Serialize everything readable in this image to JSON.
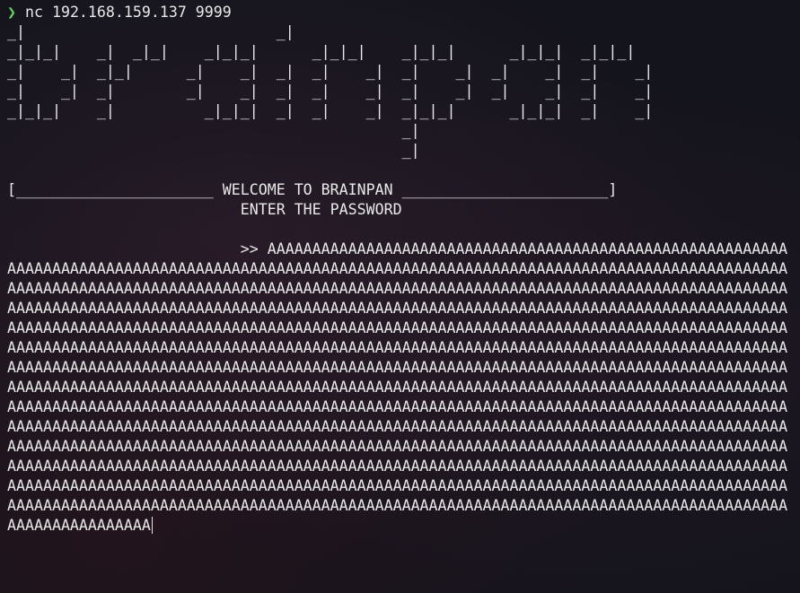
{
  "prompt": {
    "symbol": "❯",
    "command": " nc 192.168.159.137 9999"
  },
  "banner_art": "_|                            _|                                        \n_|_|_|    _|  _|_|    _|_|_|      _|_|_|    _|_|_|      _|_|_|  _|_|_|  \n_|    _|  _|_|      _|    _|  _|  _|    _|  _|    _|  _|    _|  _|    _|\n_|    _|  _|        _|    _|  _|  _|    _|  _|    _|  _|    _|  _|    _|\n_|_|_|    _|          _|_|_|  _|  _|    _|  _|_|_|      _|_|_|  _|    _|\n                                            _|                          \n                                            _|",
  "welcome_line": "[______________________ WELCOME TO BRAINPAN _______________________]",
  "password_prompt_line": "                          ENTER THE PASSWORD",
  "input_prefix": "                          >> ",
  "input_value": "AAAAAAAAAAAAAAAAAAAAAAAAAAAAAAAAAAAAAAAAAAAAAAAAAAAAAAAAAAAAAAAAAAAAAAAAAAAAAAAAAAAAAAAAAAAAAAAAAAAAAAAAAAAAAAAAAAAAAAAAAAAAAAAAAAAAAAAAAAAAAAAAAAAAAAAAAAAAAAAAAAAAAAAAAAAAAAAAAAAAAAAAAAAAAAAAAAAAAAAAAAAAAAAAAAAAAAAAAAAAAAAAAAAAAAAAAAAAAAAAAAAAAAAAAAAAAAAAAAAAAAAAAAAAAAAAAAAAAAAAAAAAAAAAAAAAAAAAAAAAAAAAAAAAAAAAAAAAAAAAAAAAAAAAAAAAAAAAAAAAAAAAAAAAAAAAAAAAAAAAAAAAAAAAAAAAAAAAAAAAAAAAAAAAAAAAAAAAAAAAAAAAAAAAAAAAAAAAAAAAAAAAAAAAAAAAAAAAAAAAAAAAAAAAAAAAAAAAAAAAAAAAAAAAAAAAAAAAAAAAAAAAAAAAAAAAAAAAAAAAAAAAAAAAAAAAAAAAAAAAAAAAAAAAAAAAAAAAAAAAAAAAAAAAAAAAAAAAAAAAAAAAAAAAAAAAAAAAAAAAAAAAAAAAAAAAAAAAAAAAAAAAAAAAAAAAAAAAAAAAAAAAAAAAAAAAAAAAAAAAAAAAAAAAAAAAAAAAAAAAAAAAAAAAAAAAAAAAAAAAAAAAAAAAAAAAAAAAAAAAAAAAAAAAAAAAAAAAAAAAAAAAAAAAAAAAAAAAAAAAAAAAAAAAAAAAAAAAAAAAAAAAAAAAAAAAAAAAAAAAAAAAAAAAAAAAAAAAAAAAAAAAAAAAAAAAAAAAAAAAAAAAAAAAAAAAAAAAAAAAAAAAAAAAAAAAAAAAAAAAAAAAAAAAAAAAAAAAAAAAAAAAAAAAAAAAAAAAAAAAAAAAAAAAAAAAAAAAAAAAAAAAAAAAAAAAAAAAAAAAAAAAAAAAAAAAAAAAAAAAAAAAAAAAAAAAAAAAAAAAAAAAAAAAAAAAAAAAAAAAAAAAAAAAAAAAAAAAAAAAAAAAAAAAAAAAAAAAAAAAAAAAAAAAAAAAAAAAAAAAAAAAAAAAAAAAAAAAAAAAAAAAAAAAAAAAAAAAAAAAAAAAAAAAAAAAAAAAAAAAAAAAAAAAAAAAAAAAAAAAAAAAAAAAAAAAAAAAAAAAAAAAAAAAAAAAAAAAAAAAAAAAAAAAAAAAAAAAAAAAAAAAA"
}
